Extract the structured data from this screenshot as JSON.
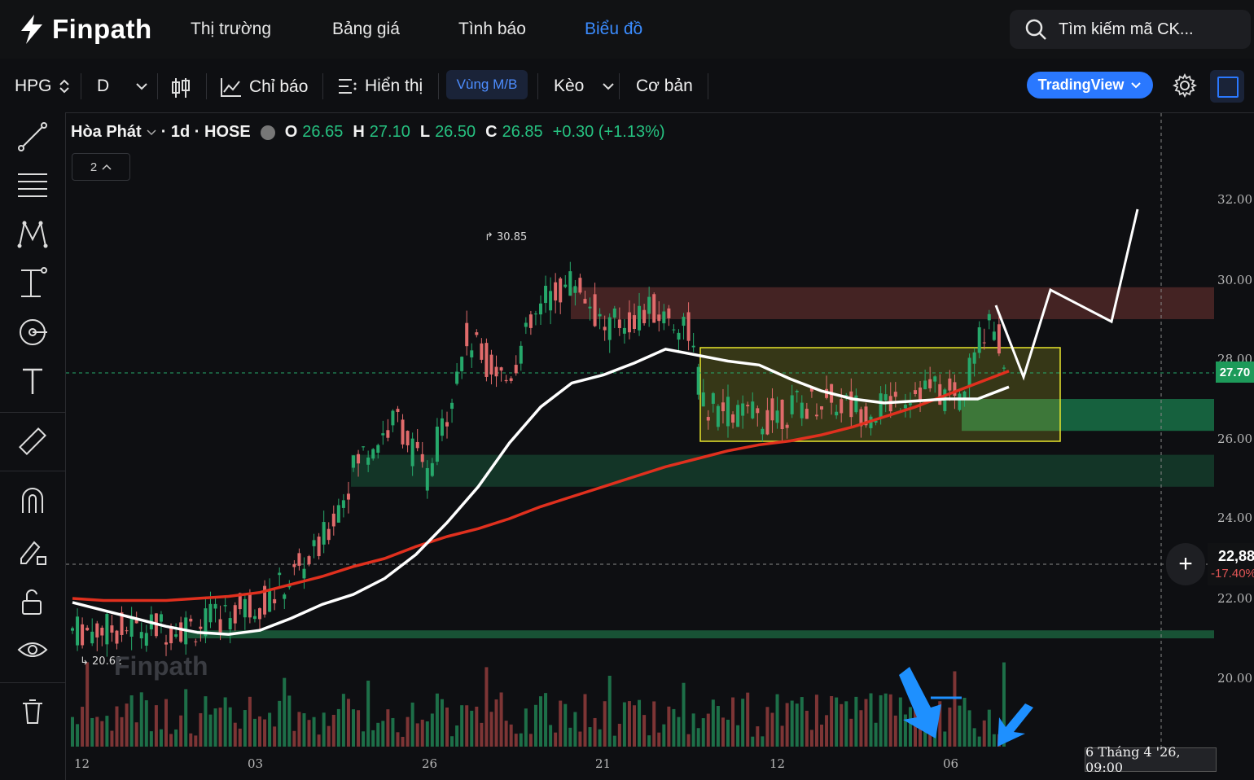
{
  "app": {
    "logo_text": "Finpath",
    "nav": [
      {
        "label": "Thị trường",
        "active": false
      },
      {
        "label": "Bảng giá",
        "active": false
      },
      {
        "label": "Tình báo",
        "active": false
      },
      {
        "label": "Biểu đồ",
        "active": true
      }
    ],
    "search_placeholder": "Tìm kiếm mã CK..."
  },
  "toolbar": {
    "symbol": "HPG",
    "interval": "D",
    "indicators_label": "Chỉ báo",
    "display_label": "Hiển thị",
    "zone_label": "Vùng M/B",
    "keo_label": "Kèo",
    "basic_label": "Cơ bản",
    "tradingview_label": "TradingView"
  },
  "legend": {
    "name": "Hòa Phát",
    "meta": "· 1d · HOSE",
    "o_label": "O",
    "o_value": "26.65",
    "h_label": "H",
    "h_value": "27.10",
    "l_label": "L",
    "l_value": "26.50",
    "c_label": "C",
    "c_value": "26.85",
    "change": "+0.30 (+1.13%)",
    "collapse_count": "2"
  },
  "chart_data": {
    "type": "line",
    "price_axis_ticks": [
      "32.00",
      "30.00",
      "28.00",
      "26.00",
      "24.00",
      "22.00",
      "20.00"
    ],
    "time_axis_ticks": [
      "12",
      "03",
      "26",
      "21",
      "12",
      "06"
    ],
    "last_price": "27.70",
    "crosshair_price": "22,88",
    "crosshair_change": "-17.40%",
    "crosshair_date": "6 Tháng 4 '26, 09:00",
    "high_annotation": "30.85",
    "low_annotation": "20.62",
    "watermark": "Finpath",
    "y_range": [
      19.6,
      33.5
    ],
    "ma_short": [
      21.9,
      21.7,
      21.5,
      21.3,
      21.15,
      21.1,
      21.2,
      21.5,
      21.85,
      22.1,
      22.5,
      23.1,
      23.9,
      24.8,
      25.9,
      26.8,
      27.4,
      27.6,
      27.9,
      28.25,
      28.1,
      27.95,
      27.85,
      27.5,
      27.2,
      27.0,
      26.9,
      26.95,
      27.0,
      27.0,
      27.3
    ],
    "ma_long": [
      22.0,
      21.95,
      21.95,
      21.95,
      22.0,
      22.05,
      22.15,
      22.35,
      22.55,
      22.8,
      23.0,
      23.3,
      23.55,
      23.75,
      24.0,
      24.3,
      24.55,
      24.8,
      25.05,
      25.3,
      25.5,
      25.7,
      25.85,
      25.95,
      26.1,
      26.3,
      26.55,
      26.8,
      27.1,
      27.4,
      27.7
    ],
    "zones": [
      {
        "type": "resistance",
        "from": 29.0,
        "to": 29.8,
        "color": "#4a2626"
      },
      {
        "type": "support",
        "from": 24.8,
        "to": 25.6,
        "color": "#143a2a"
      },
      {
        "type": "support",
        "from": 26.2,
        "to": 27.0,
        "color": "#176a44"
      },
      {
        "type": "support",
        "from": 21.0,
        "to": 21.2,
        "color": "#1a5a3a"
      }
    ]
  },
  "colors": {
    "accent": "#2a78ff",
    "up": "#26a86b",
    "down": "#e06b6b",
    "ma_short": "#ffffff",
    "ma_long": "#e0301e",
    "rect_box": "#e8e62c",
    "arrow_blue": "#1e90ff"
  }
}
